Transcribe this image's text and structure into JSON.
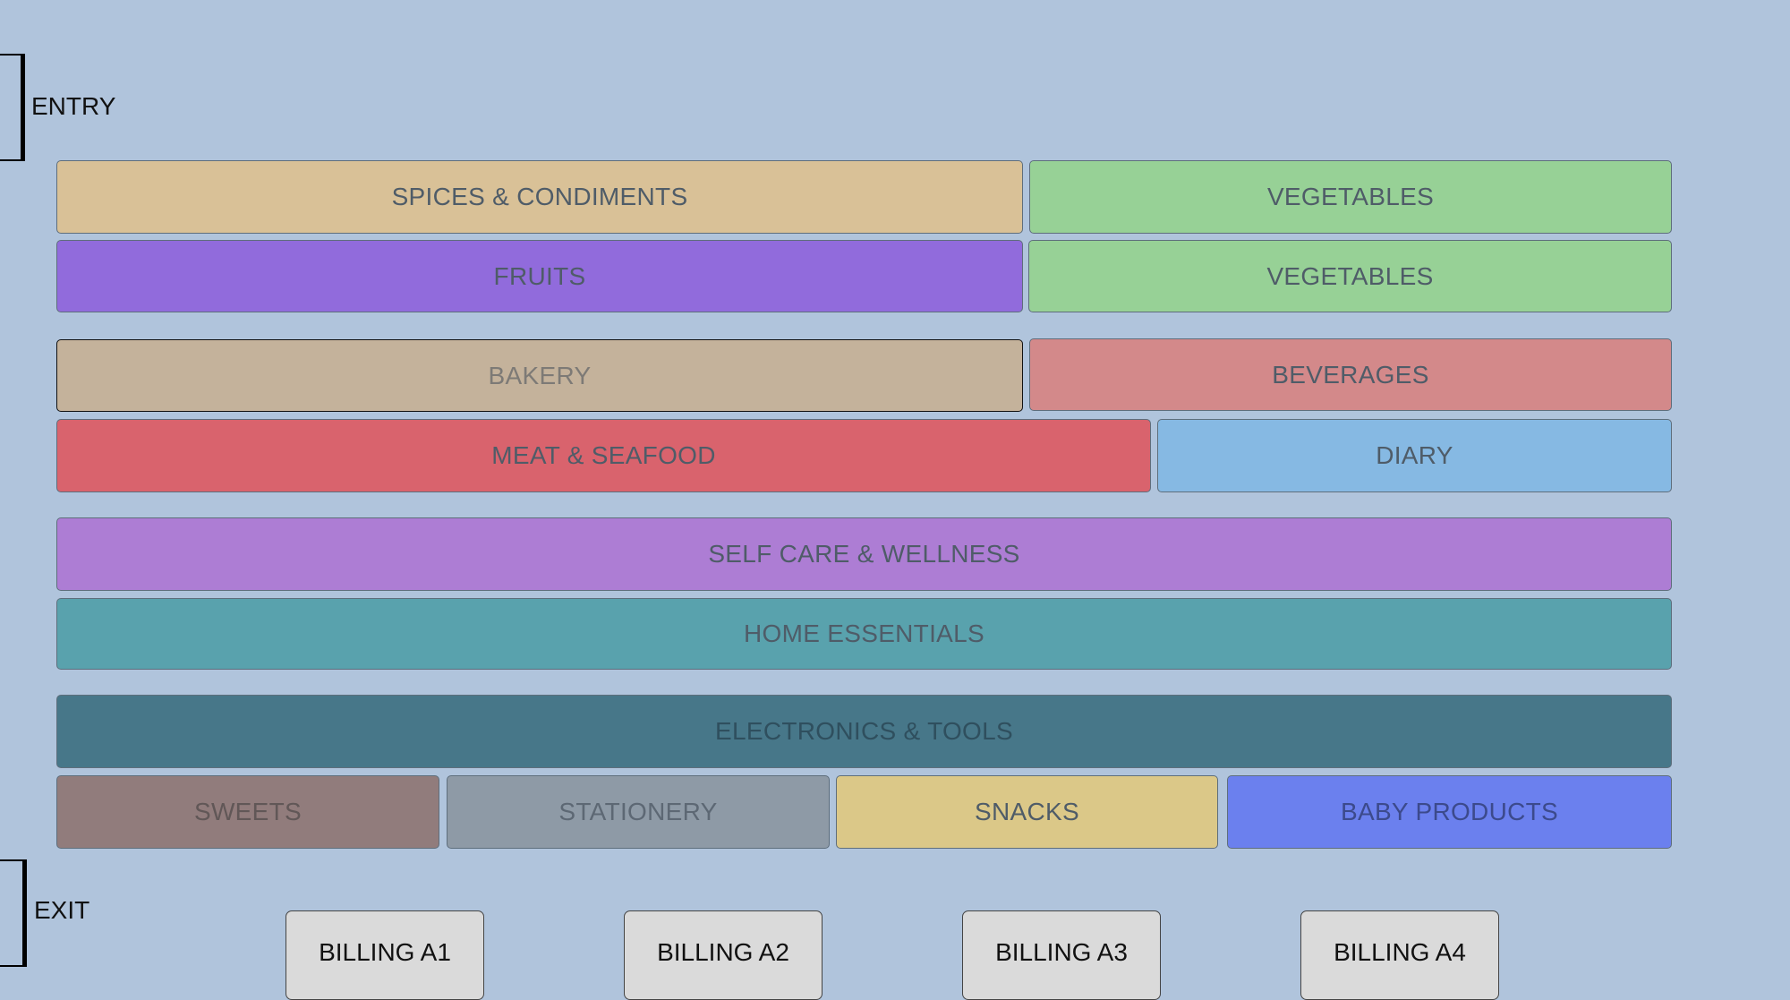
{
  "entry": {
    "label": "ENTRY"
  },
  "exit": {
    "label": "EXIT"
  },
  "aisles": {
    "spices": {
      "label": "SPICES & CONDIMENTS",
      "color": "#d9c197"
    },
    "vegetables1": {
      "label": "VEGETABLES",
      "color": "#97d196"
    },
    "fruits": {
      "label": "FRUITS",
      "color": "#916bdc"
    },
    "vegetables2": {
      "label": "VEGETABLES",
      "color": "#97d196"
    },
    "bakery": {
      "label": "BAKERY",
      "color": "#c4b29b"
    },
    "beverages": {
      "label": "BEVERAGES",
      "color": "#d3898a"
    },
    "meat": {
      "label": "MEAT & SEAFOOD",
      "color": "#d9636d"
    },
    "diary": {
      "label": "DIARY",
      "color": "#86b9e3"
    },
    "selfcare": {
      "label": "SELF CARE & WELLNESS",
      "color": "#ad7dd4"
    },
    "home": {
      "label": "HOME ESSENTIALS",
      "color": "#59a2ad"
    },
    "electronics": {
      "label": "ELECTRONICS & TOOLS",
      "color": "#477789"
    },
    "sweets": {
      "label": "SWEETS",
      "color": "#917c7c"
    },
    "stationery": {
      "label": "STATIONERY",
      "color": "#8e9aa6"
    },
    "snacks": {
      "label": "SNACKS",
      "color": "#dbc888"
    },
    "baby": {
      "label": "BABY PRODUCTS",
      "color": "#6b80ee"
    }
  },
  "billing": [
    {
      "label": "BILLING A1"
    },
    {
      "label": "BILLING A2"
    },
    {
      "label": "BILLING A3"
    },
    {
      "label": "BILLING A4"
    }
  ]
}
